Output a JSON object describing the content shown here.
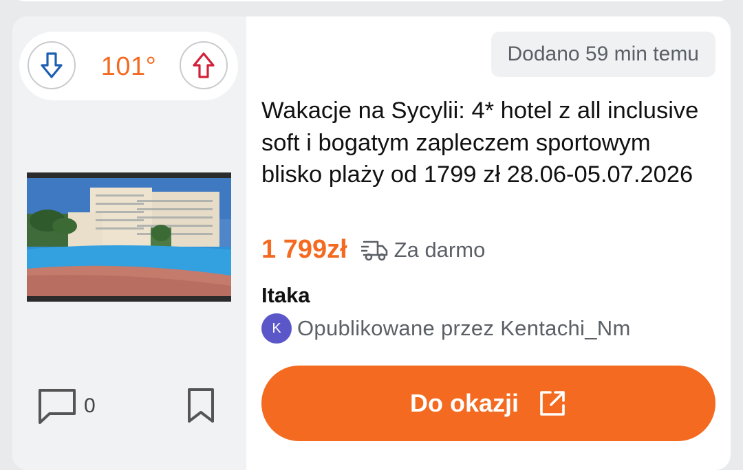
{
  "vote": {
    "temperature": "101°",
    "down_icon": "arrow-down-icon",
    "up_icon": "arrow-up-icon",
    "down_color": "#1d5fb3",
    "up_color": "#d3203a"
  },
  "deal": {
    "added": "Dodano 59 min temu",
    "title": "Wakacje na Sycylii: 4* hotel z all inclusive soft i bogatym zapleczem sportowym blisko plaży od 1799 zł 28.06-05.07.2026",
    "price": "1 799zł",
    "shipping": "Za darmo",
    "merchant": "Itaka",
    "poster_avatar": "K",
    "poster": "Opublikowane przez Kentachi_Nm",
    "button_label": "Do okazji",
    "comments_count": "0"
  },
  "colors": {
    "accent": "#f36a20",
    "avatar": "#5c57c8"
  }
}
